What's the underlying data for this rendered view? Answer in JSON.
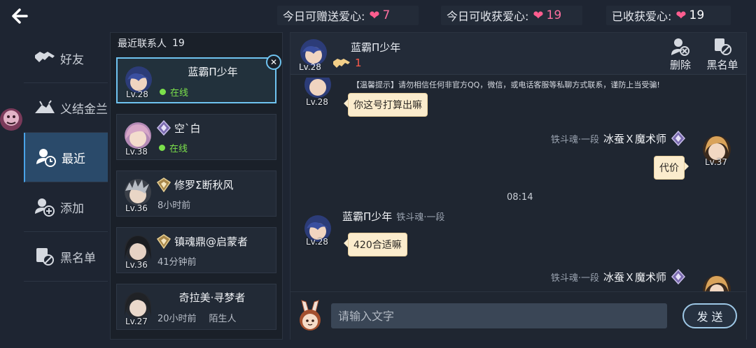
{
  "top": {
    "can_send_label": "今日可赠送爱心:",
    "can_send_value": "7",
    "can_receive_label": "今日可收获爱心:",
    "can_receive_value": "19",
    "received_label": "已收获爱心:",
    "received_value": "19"
  },
  "nav": {
    "items": [
      {
        "label": "好友",
        "icon": "handshake-icon"
      },
      {
        "label": "义结金兰",
        "icon": "sworn-brothers-icon"
      },
      {
        "label": "最近",
        "icon": "recent-user-icon",
        "active": true
      },
      {
        "label": "添加",
        "icon": "add-user-icon"
      },
      {
        "label": "黑名单",
        "icon": "blacklist-icon"
      }
    ]
  },
  "contacts": {
    "title": "最近联系人",
    "count": "19",
    "items": [
      {
        "name": "蓝霸Π少年",
        "level": "Lv.28",
        "status": "在线"
      },
      {
        "name": "空`白",
        "level": "Lv.38",
        "status": "在线"
      },
      {
        "name": "修罗Σ断秋风",
        "level": "Lv.36",
        "meta": "8小时前"
      },
      {
        "name": "镇魂鼎@启蒙者",
        "level": "Lv.36",
        "meta": "41分钟前"
      },
      {
        "name": "奇拉美·寻梦者",
        "level": "Lv.27",
        "meta": "20小时前",
        "meta2": "陌生人"
      }
    ]
  },
  "chat": {
    "title": "蓝霸Π少年",
    "level": "Lv.28",
    "friendship": "1",
    "delete_label": "删除",
    "blacklist_label": "黑名单",
    "notice": "【温馨提示】请勿相信任何非官方QQ，微信，或电话客服等私聊方式联系，谨防上当受骗!",
    "messages": [
      {
        "side": "left",
        "level": "Lv.28",
        "text": "你这号打算出嘛"
      },
      {
        "side": "right",
        "sender": "冰蚕Ｘ魔术师",
        "rank": "铁斗魂·一段",
        "level": "Lv.37",
        "text": "代价"
      },
      {
        "time": "08:14"
      },
      {
        "side": "left",
        "sender": "蓝霸Π少年",
        "rank": "铁斗魂·一段",
        "level": "Lv.28",
        "text": "420合适嘛"
      },
      {
        "side": "right",
        "sender": "冰蚕Ｘ魔术师",
        "rank": "铁斗魂·一段"
      }
    ],
    "input_placeholder": "请输入文字",
    "send_label": "发 送"
  },
  "colors": {
    "background": "#1e2532",
    "active_nav": "#2a4a6a",
    "heart": "#ff5d8f",
    "online": "#7be04b",
    "bubble": "#fbeccd",
    "selected_border": "#6fc3f0"
  }
}
